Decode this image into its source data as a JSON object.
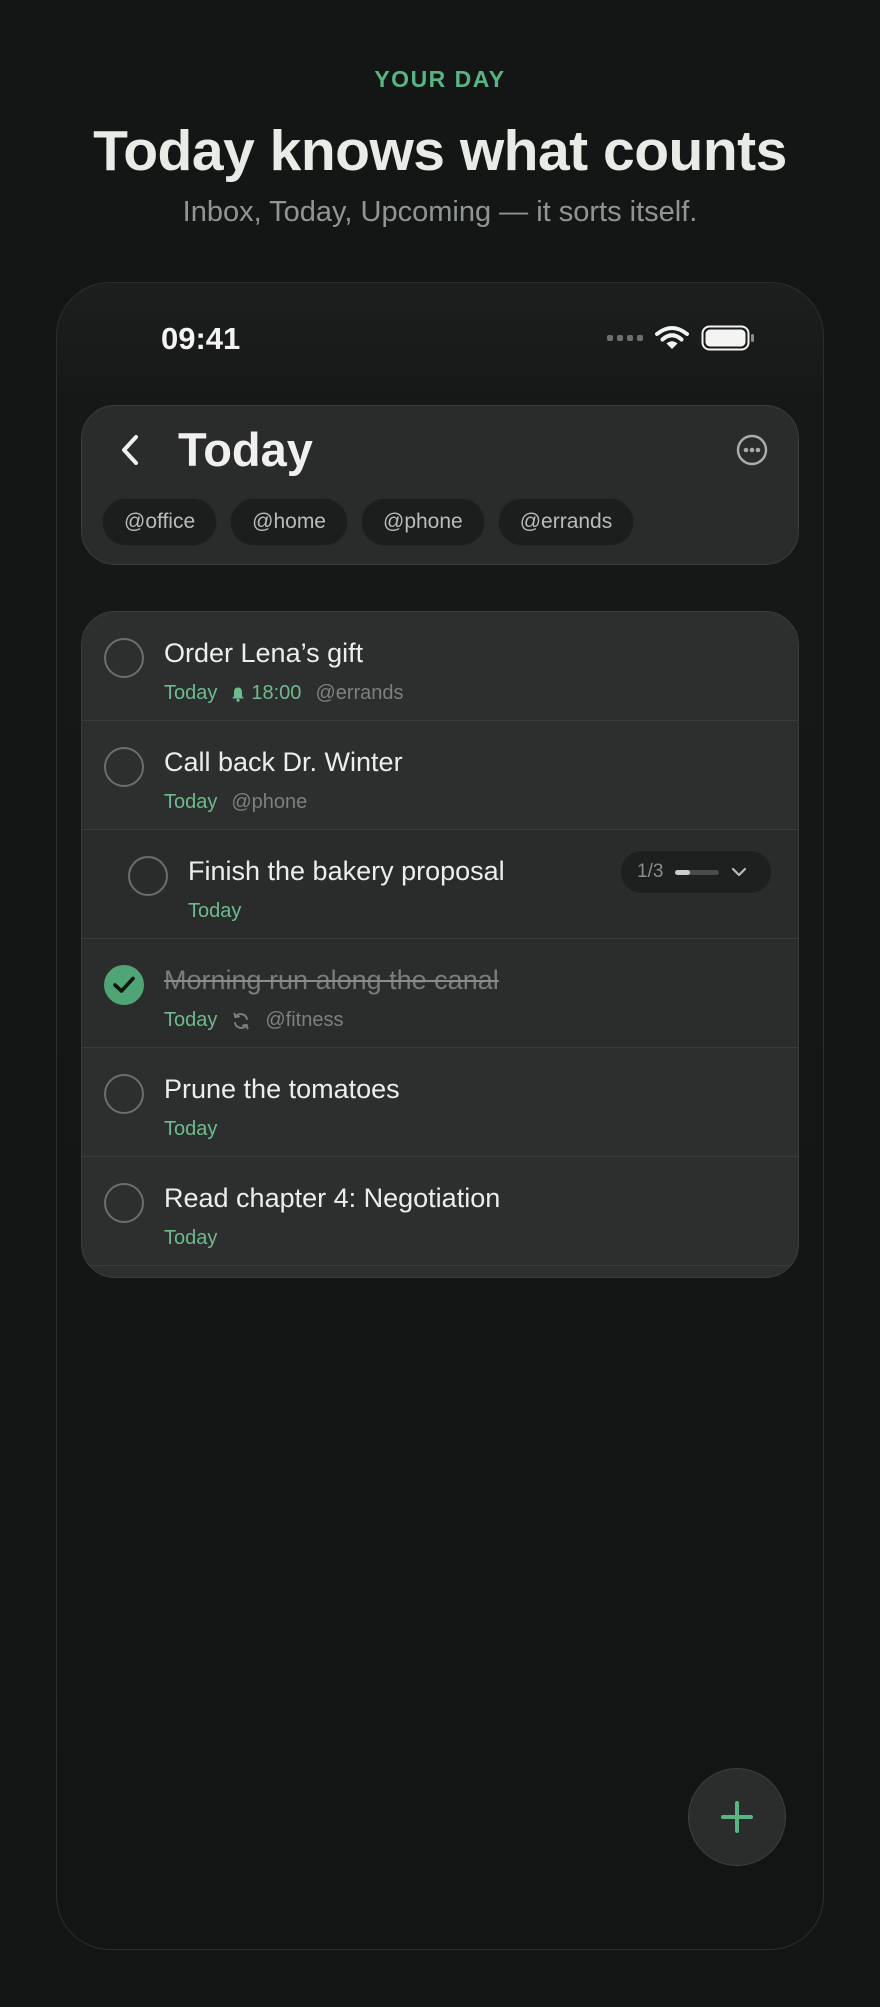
{
  "hero": {
    "eyebrow": "YOUR DAY",
    "headline": "Today knows what counts",
    "subhead": "Inbox, Today, Upcoming — it sorts itself."
  },
  "status_bar": {
    "time": "09:41"
  },
  "header": {
    "title": "Today",
    "chips": [
      "@office",
      "@home",
      "@phone",
      "@errands"
    ]
  },
  "tasks": [
    {
      "title": "Order Lena’s gift",
      "when": "Today",
      "reminder": "18:00",
      "context": "@errands",
      "done": false
    },
    {
      "title": "Call back Dr. Winter",
      "when": "Today",
      "context": "@phone",
      "done": false
    },
    {
      "title": "Finish the bakery proposal",
      "when": "Today",
      "subtask_progress": "1/3",
      "progress_fraction": 0.33,
      "done": false,
      "indented": true
    },
    {
      "title": "Morning run along the canal",
      "when": "Today",
      "recurring": true,
      "context": "@fitness",
      "done": true
    },
    {
      "title": "Prune the tomatoes",
      "when": "Today",
      "done": false
    },
    {
      "title": "Read chapter 4: Negotiation",
      "when": "Today",
      "done": false
    }
  ],
  "colors": {
    "accent": "#58b583",
    "background": "#141616",
    "card": "#2d2e2e",
    "checked": "#4fa575"
  },
  "icons": [
    "back-chevron-icon",
    "more-icon",
    "bell-icon",
    "repeat-icon",
    "chevron-down-icon",
    "plus-icon",
    "wifi-icon",
    "battery-icon",
    "signal-icon"
  ]
}
